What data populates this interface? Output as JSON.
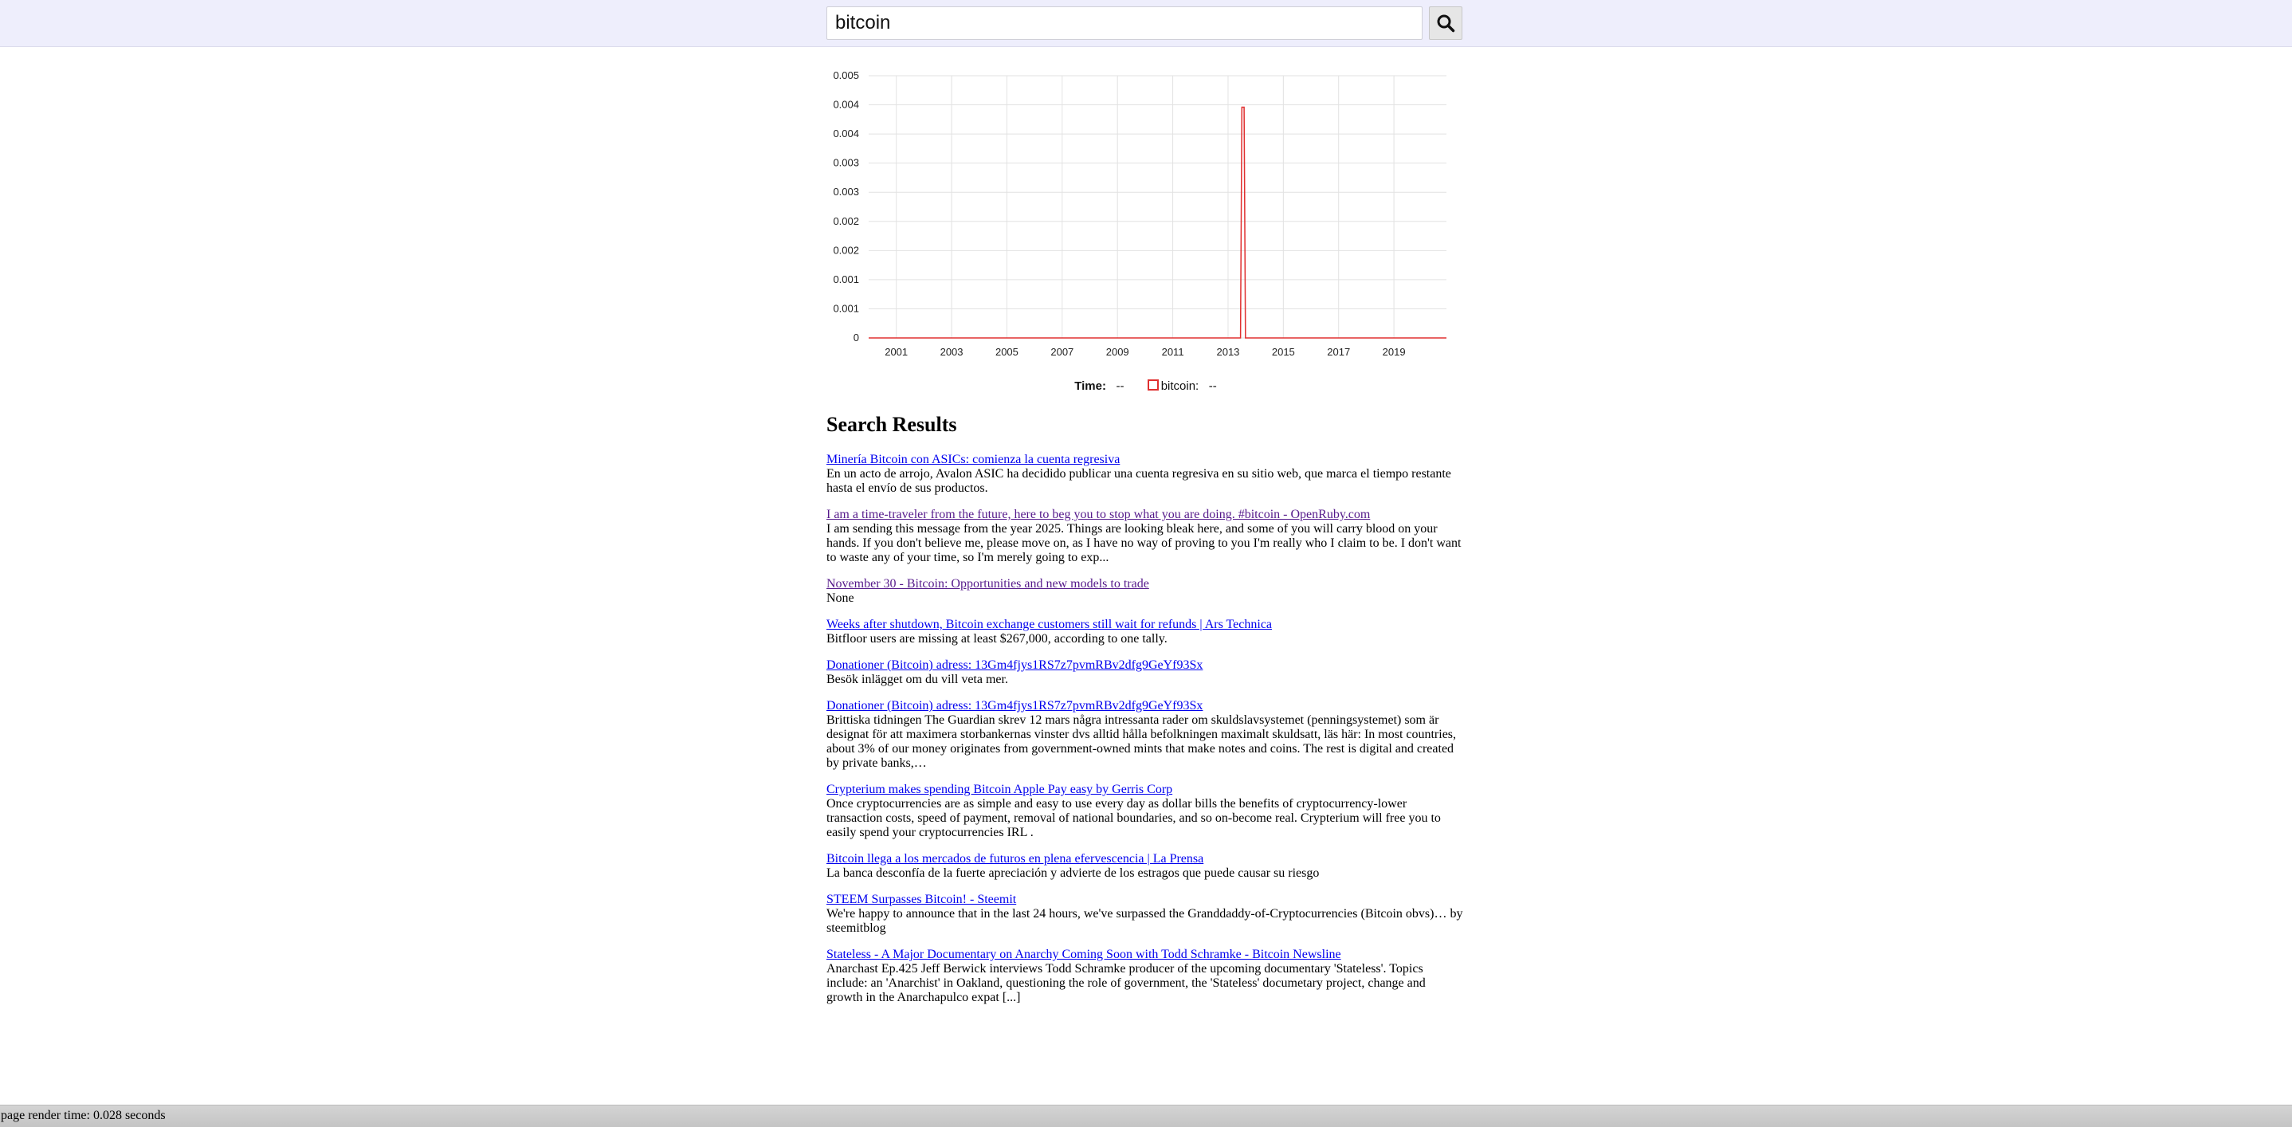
{
  "search": {
    "value": "bitcoin",
    "icon": "search-icon"
  },
  "chart_data": {
    "type": "line",
    "title": "",
    "xlabel": "",
    "ylabel": "",
    "x_tick_labels": [
      "2001",
      "2003",
      "2005",
      "2007",
      "2009",
      "2011",
      "2013",
      "2015",
      "2017",
      "2019"
    ],
    "y_tick_labels": [
      "0",
      "0.001",
      "0.001",
      "0.002",
      "0.002",
      "0.003",
      "0.003",
      "0.004",
      "0.004",
      "0.005"
    ],
    "xlim": [
      2000,
      2020.9
    ],
    "ylim": [
      0,
      0.005
    ],
    "grid": true,
    "series": [
      {
        "name": "bitcoin",
        "color": "#e03030",
        "x": [
          2000,
          2013.45,
          2013.5,
          2013.58,
          2013.63,
          2020.9
        ],
        "y": [
          0,
          0,
          0.0044,
          0.0044,
          0,
          0
        ]
      }
    ]
  },
  "legend": {
    "time_label": "Time:",
    "time_value": "--",
    "series_label": "bitcoin:",
    "series_value": "--"
  },
  "results_heading": "Search Results",
  "results": [
    {
      "title": "Minería Bitcoin con ASICs: comienza la cuenta regresiva",
      "snippet": "En un acto de arrojo, Avalon ASIC ha decidido publicar una cuenta regresiva en su sitio web, que marca el tiempo restante hasta el envío de sus productos.",
      "visited": false
    },
    {
      "title": "I am a time-traveler from the future, here to beg you to stop what you are doing. #bitcoin - OpenRuby.com",
      "snippet": "I am sending this message from the year 2025. Things are looking bleak here, and some of you will carry blood on your hands. If you don't believe me, please move on, as I have no way of proving to you I'm really who I claim to be. I don't want to waste any of your time, so I'm merely going to exp...",
      "visited": true
    },
    {
      "title": "November 30 - Bitcoin: Opportunities and new models to trade",
      "snippet": "None",
      "visited": true
    },
    {
      "title": "Weeks after shutdown, Bitcoin exchange customers still wait for refunds | Ars Technica",
      "snippet": "Bitfloor users are missing at least $267,000, according to one tally.",
      "visited": false
    },
    {
      "title": "Donationer (Bitcoin) adress: 13Gm4fjys1RS7z7pvmRBv2dfg9GeYf93Sx",
      "snippet": "Besök inlägget om du vill veta mer.",
      "visited": false
    },
    {
      "title": "Donationer (Bitcoin) adress: 13Gm4fjys1RS7z7pvmRBv2dfg9GeYf93Sx",
      "snippet": "Brittiska tidningen The Guardian skrev 12 mars några intressanta rader om skuldslavsystemet (penningsystemet) som är designat för att maximera storbankernas vinster dvs alltid hålla befolkningen maximalt skuldsatt, läs här: In most countries, about 3% of our money originates from government-owned mints that make notes and coins. The rest is digital and created by private banks,…",
      "visited": false
    },
    {
      "title": "Crypterium makes spending Bitcoin Apple Pay easy by Gerris Corp",
      "snippet": "Once cryptocurrencies are as simple and easy to use every day as dollar bills the benefits of cryptocurrency-lower transaction costs, speed of payment, removal of national boundaries, and so on-become real. Crypterium will free you to easily spend your cryptocurrencies IRL .",
      "visited": false
    },
    {
      "title": "Bitcoin llega a los mercados de futuros en plena efervescencia | La Prensa",
      "snippet": "La banca desconfía de la fuerte apreciación y advierte de los estragos que puede causar su riesgo",
      "visited": false
    },
    {
      "title": "STEEM Surpasses Bitcoin! - Steemit",
      "snippet": "We're happy to announce that in the last 24 hours, we've surpassed the Granddaddy-of-Cryptocurrencies (Bitcoin obvs)… by steemitblog",
      "visited": false
    },
    {
      "title": "Stateless - A Major Documentary on Anarchy Coming Soon with Todd Schramke - Bitcoin Newsline",
      "snippet": "Anarchast Ep.425 Jeff Berwick interviews Todd Schramke producer of the upcoming documentary 'Stateless'. Topics include: an 'Anarchist' in Oakland, questioning the role of government, the 'Stateless' documetary project, change and growth in the Anarchapulco expat [...]",
      "visited": false
    }
  ],
  "footer": {
    "render_time": "page render time: 0.028 seconds"
  }
}
